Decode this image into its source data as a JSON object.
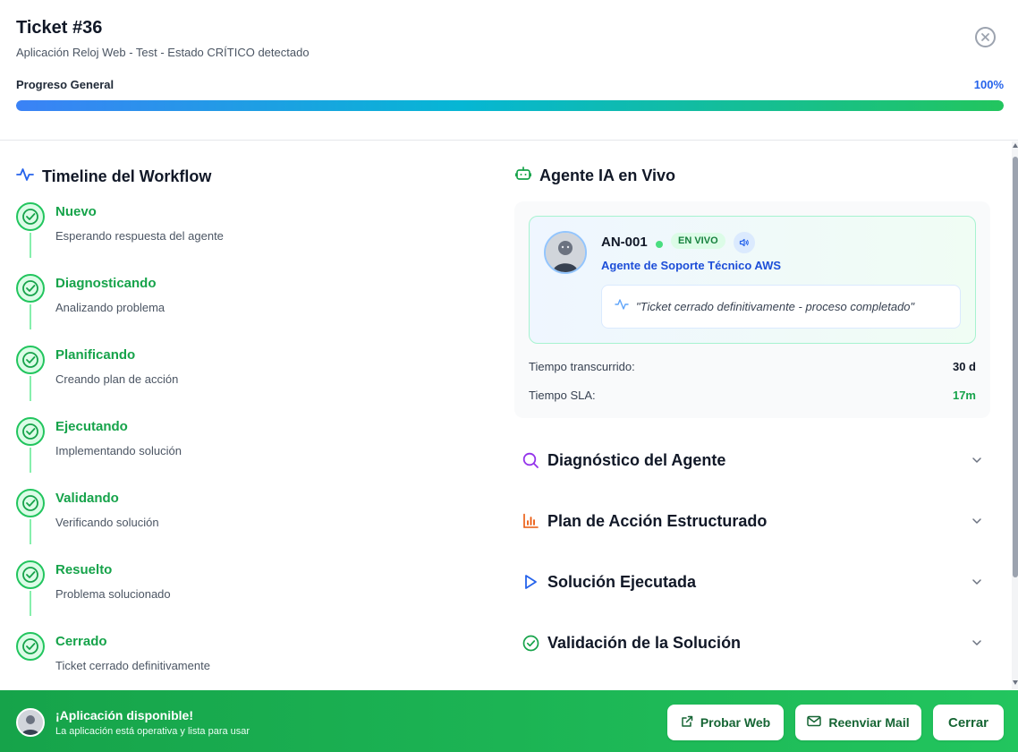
{
  "header": {
    "title": "Ticket #36",
    "subtitle": "Aplicación Reloj Web - Test - Estado CRÍTICO detectado",
    "progress_label": "Progreso General",
    "progress_value": "100%",
    "progress_fraction": 1.0
  },
  "timeline": {
    "heading": "Timeline del Workflow",
    "steps": [
      {
        "title": "Nuevo",
        "desc": "Esperando respuesta del agente"
      },
      {
        "title": "Diagnosticando",
        "desc": "Analizando problema"
      },
      {
        "title": "Planificando",
        "desc": "Creando plan de acción"
      },
      {
        "title": "Ejecutando",
        "desc": "Implementando solución"
      },
      {
        "title": "Validando",
        "desc": "Verificando solución"
      },
      {
        "title": "Resuelto",
        "desc": "Problema solucionado"
      },
      {
        "title": "Cerrado",
        "desc": "Ticket cerrado definitivamente"
      }
    ]
  },
  "agent": {
    "heading": "Agente IA en Vivo",
    "id": "AN-001",
    "status": "EN VIVO",
    "role": "Agente de Soporte Técnico AWS",
    "quote": "\"Ticket cerrado definitivamente - proceso completado\"",
    "elapsed_label": "Tiempo transcurrido:",
    "elapsed_value": "30 d",
    "sla_label": "Tiempo SLA:",
    "sla_value": "17m"
  },
  "sections": [
    {
      "label": "Diagnóstico del Agente",
      "icon": "search-icon",
      "color": "#9333ea"
    },
    {
      "label": "Plan de Acción Estructurado",
      "icon": "bar-chart-icon",
      "color": "#ea580c"
    },
    {
      "label": "Solución Ejecutada",
      "icon": "play-icon",
      "color": "#2563eb"
    },
    {
      "label": "Validación de la Solución",
      "icon": "check-circle-icon",
      "color": "#16a34a"
    }
  ],
  "footer": {
    "title": "¡Aplicación disponible!",
    "subtitle": "La aplicación está operativa y lista para usar",
    "probar_label": "Probar Web",
    "reenviar_label": "Reenviar Mail",
    "cerrar_label": "Cerrar"
  },
  "colors": {
    "accent_blue": "#2563eb",
    "success_green": "#16a34a",
    "footer_green": "#22c55e"
  }
}
